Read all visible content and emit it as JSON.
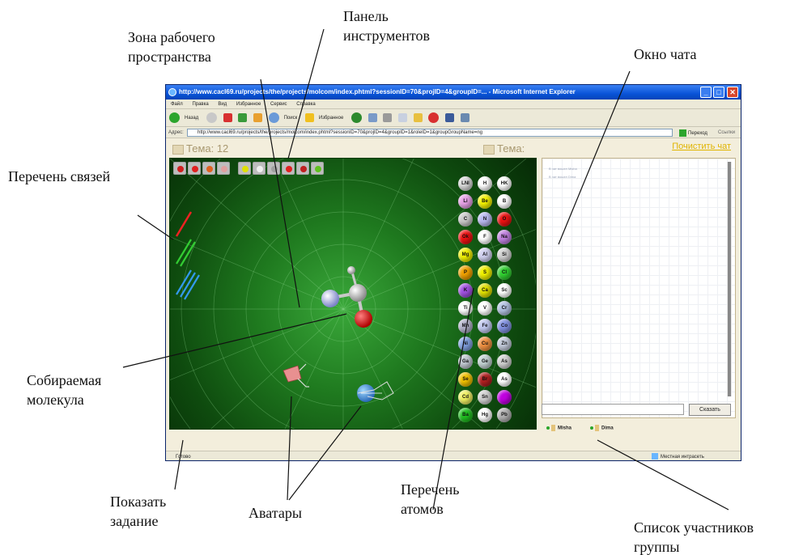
{
  "callouts": {
    "workspace": "Зона рабочего\nпространства",
    "toolbar": "Панель\nинструментов",
    "chat": "Окно чата",
    "bonds": "Перечень связей",
    "molecule": "Собираемая\nмолекула",
    "task": "Показать\nзадание",
    "avatars": "Аватары",
    "atoms": "Перечень\nатомов",
    "members": "Список участников\nгруппы"
  },
  "browser": {
    "title": "http://www.cacl69.ru/projects/the/projects/molcom/index.phtml?sessionID=70&projID=4&groupID=... - Microsoft Internet Explorer",
    "menu": [
      "Файл",
      "Правка",
      "Вид",
      "Избранное",
      "Сервис",
      "Справка"
    ],
    "toolbar": {
      "back": "Назад",
      "search": "Поиск",
      "favorites": "Избранное"
    },
    "address_label": "Адрес:",
    "address": "http://www.cacl69.ru/projects/the/projects/molcom/index.phtml?sessionID=70&projID=4&groupID=1&roleID=1&groupGroupName=ng",
    "go": "Переход",
    "links": "Ссылки",
    "status_left": "Готово",
    "status_right": "Местная интрасеть"
  },
  "app": {
    "topic_left": "Тема: 12",
    "topic_right": "Тема:",
    "clear_chat": "Почистить чат",
    "say_button": "Сказать",
    "chat_lines": [
      "В чат вошел Misha",
      "В чат вошел Dima"
    ],
    "members": [
      "Misha",
      "Dima"
    ],
    "atoms": [
      {
        "s": "LNI",
        "c": "#d8d8d8"
      },
      {
        "s": "H",
        "c": "#ffffff"
      },
      {
        "s": "HK",
        "c": "#ffffff"
      },
      {
        "s": "Li",
        "c": "#e6a0e6"
      },
      {
        "s": "Be",
        "c": "#f2f200"
      },
      {
        "s": "B",
        "c": "#ffffff"
      },
      {
        "s": "C",
        "c": "#c8c8c8"
      },
      {
        "s": "N",
        "c": "#b8b8f0"
      },
      {
        "s": "O",
        "c": "#ee1111"
      },
      {
        "s": "Ok",
        "c": "#ee1111"
      },
      {
        "s": "F",
        "c": "#ffffff"
      },
      {
        "s": "Na",
        "c": "#c080e0"
      },
      {
        "s": "Mg",
        "c": "#f0f000"
      },
      {
        "s": "Al",
        "c": "#d0d0f0"
      },
      {
        "s": "Si",
        "c": "#d0d0d0"
      },
      {
        "s": "P",
        "c": "#f0a000"
      },
      {
        "s": "S",
        "c": "#f0f000"
      },
      {
        "s": "Cl",
        "c": "#30d030"
      },
      {
        "s": "K",
        "c": "#a050e0"
      },
      {
        "s": "Ca",
        "c": "#e0e000"
      },
      {
        "s": "Sc",
        "c": "#ffffff"
      },
      {
        "s": "Ti",
        "c": "#ffffff"
      },
      {
        "s": "V",
        "c": "#ffffff"
      },
      {
        "s": "Cr",
        "c": "#b0c0e0"
      },
      {
        "s": "Mn",
        "c": "#b0b0c8"
      },
      {
        "s": "Fe",
        "c": "#c0c8f0"
      },
      {
        "s": "Co",
        "c": "#8090e0"
      },
      {
        "s": "Ni",
        "c": "#80a0e0"
      },
      {
        "s": "Cu",
        "c": "#f09040"
      },
      {
        "s": "Zn",
        "c": "#c0c8d8"
      },
      {
        "s": "Ga",
        "c": "#c0c8d0"
      },
      {
        "s": "Ge",
        "c": "#c0d0d0"
      },
      {
        "s": "As",
        "c": "#d0d0d0"
      },
      {
        "s": "Se",
        "c": "#f0c000"
      },
      {
        "s": "Br",
        "c": "#b02020"
      },
      {
        "s": "As",
        "c": "#ffffff"
      },
      {
        "s": "Cd",
        "c": "#f0f060"
      },
      {
        "s": "Sn",
        "c": "#d0d0d0"
      },
      {
        "s": "",
        "c": "#c000e0"
      },
      {
        "s": "Ba",
        "c": "#20c020"
      },
      {
        "s": "Hg",
        "c": "#ffffff"
      },
      {
        "s": "Pb",
        "c": "#b0b0b0"
      }
    ]
  }
}
